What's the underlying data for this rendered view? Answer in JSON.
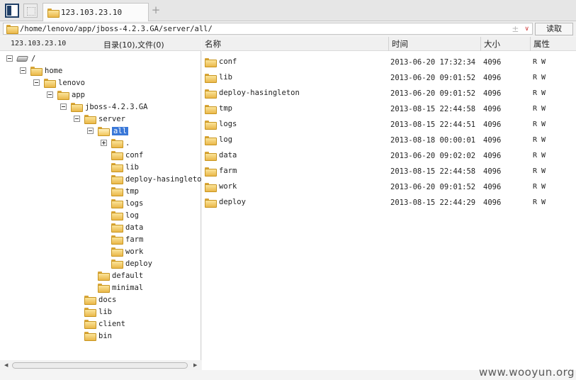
{
  "tab": {
    "label": "123.103.23.10"
  },
  "address": {
    "path": "/home/lenovo/app/jboss-4.2.3.GA/server/all/",
    "read_label": "读取"
  },
  "left_header": {
    "host": "123.103.23.10",
    "summary": "目录(10),文件(0)"
  },
  "tree": [
    {
      "label": "/",
      "depth": 0,
      "icon": "drive",
      "exp": "minus"
    },
    {
      "label": "home",
      "depth": 1,
      "icon": "folder",
      "exp": "minus"
    },
    {
      "label": "lenovo",
      "depth": 2,
      "icon": "folder",
      "exp": "minus"
    },
    {
      "label": "app",
      "depth": 3,
      "icon": "folder",
      "exp": "minus"
    },
    {
      "label": "jboss-4.2.3.GA",
      "depth": 4,
      "icon": "folder",
      "exp": "minus"
    },
    {
      "label": "server",
      "depth": 5,
      "icon": "folder",
      "exp": "minus"
    },
    {
      "label": "all",
      "depth": 6,
      "icon": "folder-open",
      "exp": "minus",
      "selected": true
    },
    {
      "label": ".",
      "depth": 7,
      "icon": "folder",
      "exp": "plus"
    },
    {
      "label": "conf",
      "depth": 7,
      "icon": "folder",
      "exp": "none"
    },
    {
      "label": "lib",
      "depth": 7,
      "icon": "folder",
      "exp": "none"
    },
    {
      "label": "deploy-hasingleton",
      "depth": 7,
      "icon": "folder",
      "exp": "none"
    },
    {
      "label": "tmp",
      "depth": 7,
      "icon": "folder",
      "exp": "none"
    },
    {
      "label": "logs",
      "depth": 7,
      "icon": "folder",
      "exp": "none"
    },
    {
      "label": "log",
      "depth": 7,
      "icon": "folder",
      "exp": "none"
    },
    {
      "label": "data",
      "depth": 7,
      "icon": "folder",
      "exp": "none"
    },
    {
      "label": "farm",
      "depth": 7,
      "icon": "folder",
      "exp": "none"
    },
    {
      "label": "work",
      "depth": 7,
      "icon": "folder",
      "exp": "none"
    },
    {
      "label": "deploy",
      "depth": 7,
      "icon": "folder",
      "exp": "none"
    },
    {
      "label": "default",
      "depth": 6,
      "icon": "folder",
      "exp": "none"
    },
    {
      "label": "minimal",
      "depth": 6,
      "icon": "folder",
      "exp": "none"
    },
    {
      "label": "docs",
      "depth": 5,
      "icon": "folder",
      "exp": "none"
    },
    {
      "label": "lib",
      "depth": 5,
      "icon": "folder",
      "exp": "none"
    },
    {
      "label": "client",
      "depth": 5,
      "icon": "folder",
      "exp": "none"
    },
    {
      "label": "bin",
      "depth": 5,
      "icon": "folder",
      "exp": "none"
    }
  ],
  "columns": {
    "name": "名称",
    "time": "时间",
    "size": "大小",
    "attr": "属性"
  },
  "files": [
    {
      "name": "conf",
      "time": "2013-06-20 17:32:34",
      "size": "4096",
      "attr": "R W"
    },
    {
      "name": "lib",
      "time": "2013-06-20 09:01:52",
      "size": "4096",
      "attr": "R W"
    },
    {
      "name": "deploy-hasingleton",
      "time": "2013-06-20 09:01:52",
      "size": "4096",
      "attr": "R W"
    },
    {
      "name": "tmp",
      "time": "2013-08-15 22:44:58",
      "size": "4096",
      "attr": "R W"
    },
    {
      "name": "logs",
      "time": "2013-08-15 22:44:51",
      "size": "4096",
      "attr": "R W"
    },
    {
      "name": "log",
      "time": "2013-08-18 00:00:01",
      "size": "4096",
      "attr": "R W"
    },
    {
      "name": "data",
      "time": "2013-06-20 09:02:02",
      "size": "4096",
      "attr": "R W"
    },
    {
      "name": "farm",
      "time": "2013-08-15 22:44:58",
      "size": "4096",
      "attr": "R W"
    },
    {
      "name": "work",
      "time": "2013-06-20 09:01:52",
      "size": "4096",
      "attr": "R W"
    },
    {
      "name": "deploy",
      "time": "2013-08-15 22:44:29",
      "size": "4096",
      "attr": "R W"
    }
  ],
  "watermark": "www.wooyun.org"
}
